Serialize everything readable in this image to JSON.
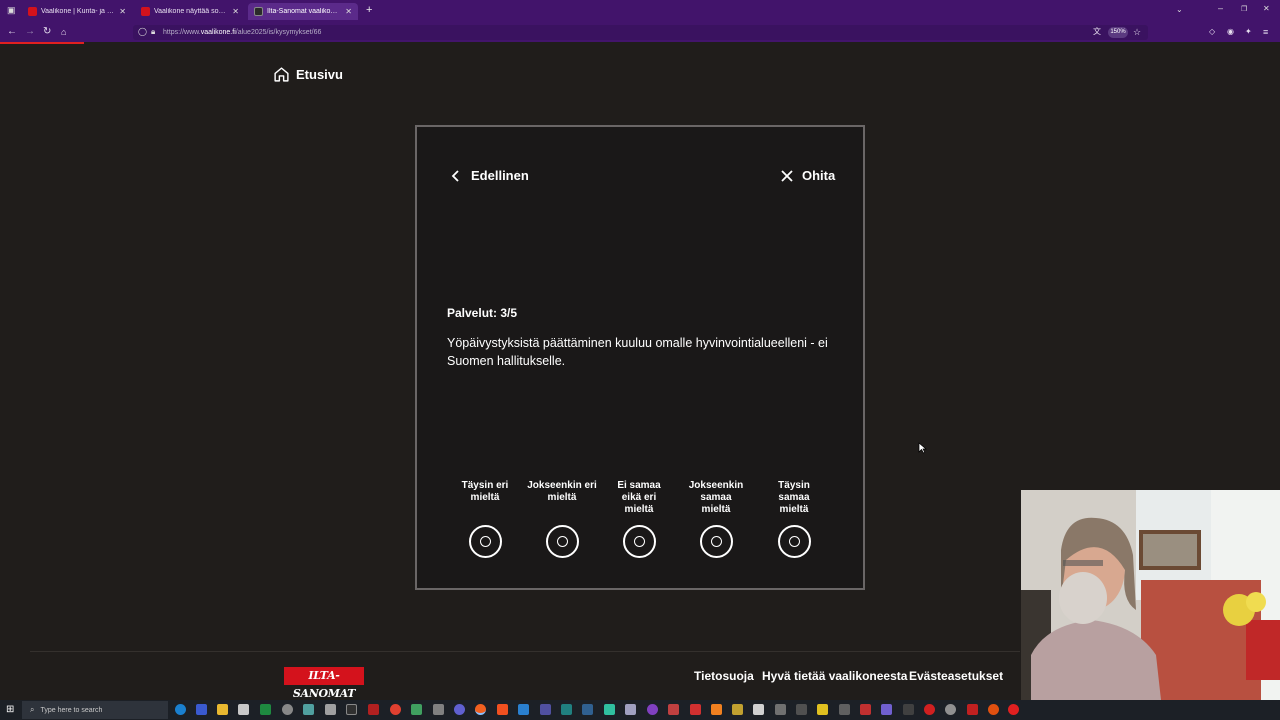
{
  "browser": {
    "tabs": [
      {
        "title": "Vaalikone | Kunta- ja aluevaalit",
        "active": false,
        "favicon_color": "#d4121c"
      },
      {
        "title": "Vaalikone näyttää sopivan ehdo",
        "active": false,
        "favicon_color": "#d4121c"
      },
      {
        "title": "Ilta-Sanomat vaalikone – Aluev",
        "active": true,
        "favicon_color": "#2a2a2a"
      }
    ],
    "new_tab": "+",
    "url_domain": "vaalikone.fi",
    "url_prefix": "https://www.",
    "url_path": "/alue2025/is/kysymykset/66",
    "zoom": "150%"
  },
  "page": {
    "home_label": "Etusivu",
    "prev_label": "Edellinen",
    "skip_label": "Ohita",
    "question_category": "Palvelut: 3/5",
    "question_text": "Yöpäivystyksistä päättäminen kuuluu omalle hyvinvointialueelleni - ei Suomen hallitukselle.",
    "options": [
      "Täysin eri mieltä",
      "Jokseenkin eri mieltä",
      "Ei samaa eikä eri mieltä",
      "Jokseenkin samaa mieltä",
      "Täysin samaa mieltä"
    ]
  },
  "footer": {
    "logo": "ILTA-SANOMAT",
    "links": [
      "Tietosuoja",
      "Hyvä tietää vaalikoneesta",
      "Evästeasetukset"
    ]
  },
  "taskbar": {
    "search_placeholder": "Type here to search"
  },
  "colors": {
    "browser_chrome": "#42146b",
    "page_bg": "#201d1b",
    "brand_red": "#d4121c"
  }
}
